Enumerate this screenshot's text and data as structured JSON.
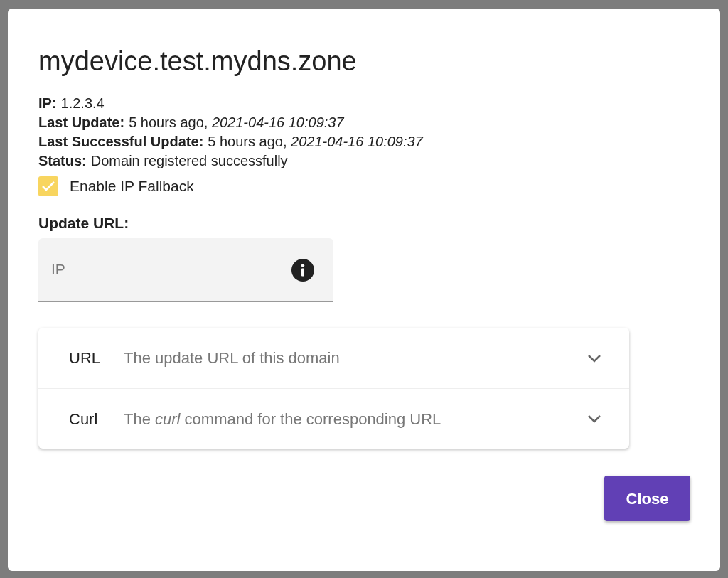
{
  "dialog": {
    "title": "mydevice.test.mydns.zone",
    "details": [
      {
        "label": "IP:",
        "value": "1.2.3.4"
      },
      {
        "label": "Last Update:",
        "value": "5 hours ago, *2021-04-16 10:09:37*"
      },
      {
        "label": "Last Successful Update:",
        "value": "5 hours ago, *2021-04-16 10:09:37*"
      },
      {
        "label": "Status:",
        "value": "Domain registered successfully"
      }
    ],
    "ip_fallback": {
      "label": "Enable IP Fallback",
      "checked": true
    },
    "update_url": {
      "label": "Update URL:",
      "field": {
        "placeholder": "IP"
      }
    },
    "accordion": [
      {
        "title": "URL",
        "description": "The update URL of this domain",
        "expanded": false
      },
      {
        "title": "Curl",
        "description": "The *curl* command for the corresponding URL",
        "expanded": false
      }
    ],
    "buttons": [
      {
        "label": "Close"
      }
    ]
  }
}
